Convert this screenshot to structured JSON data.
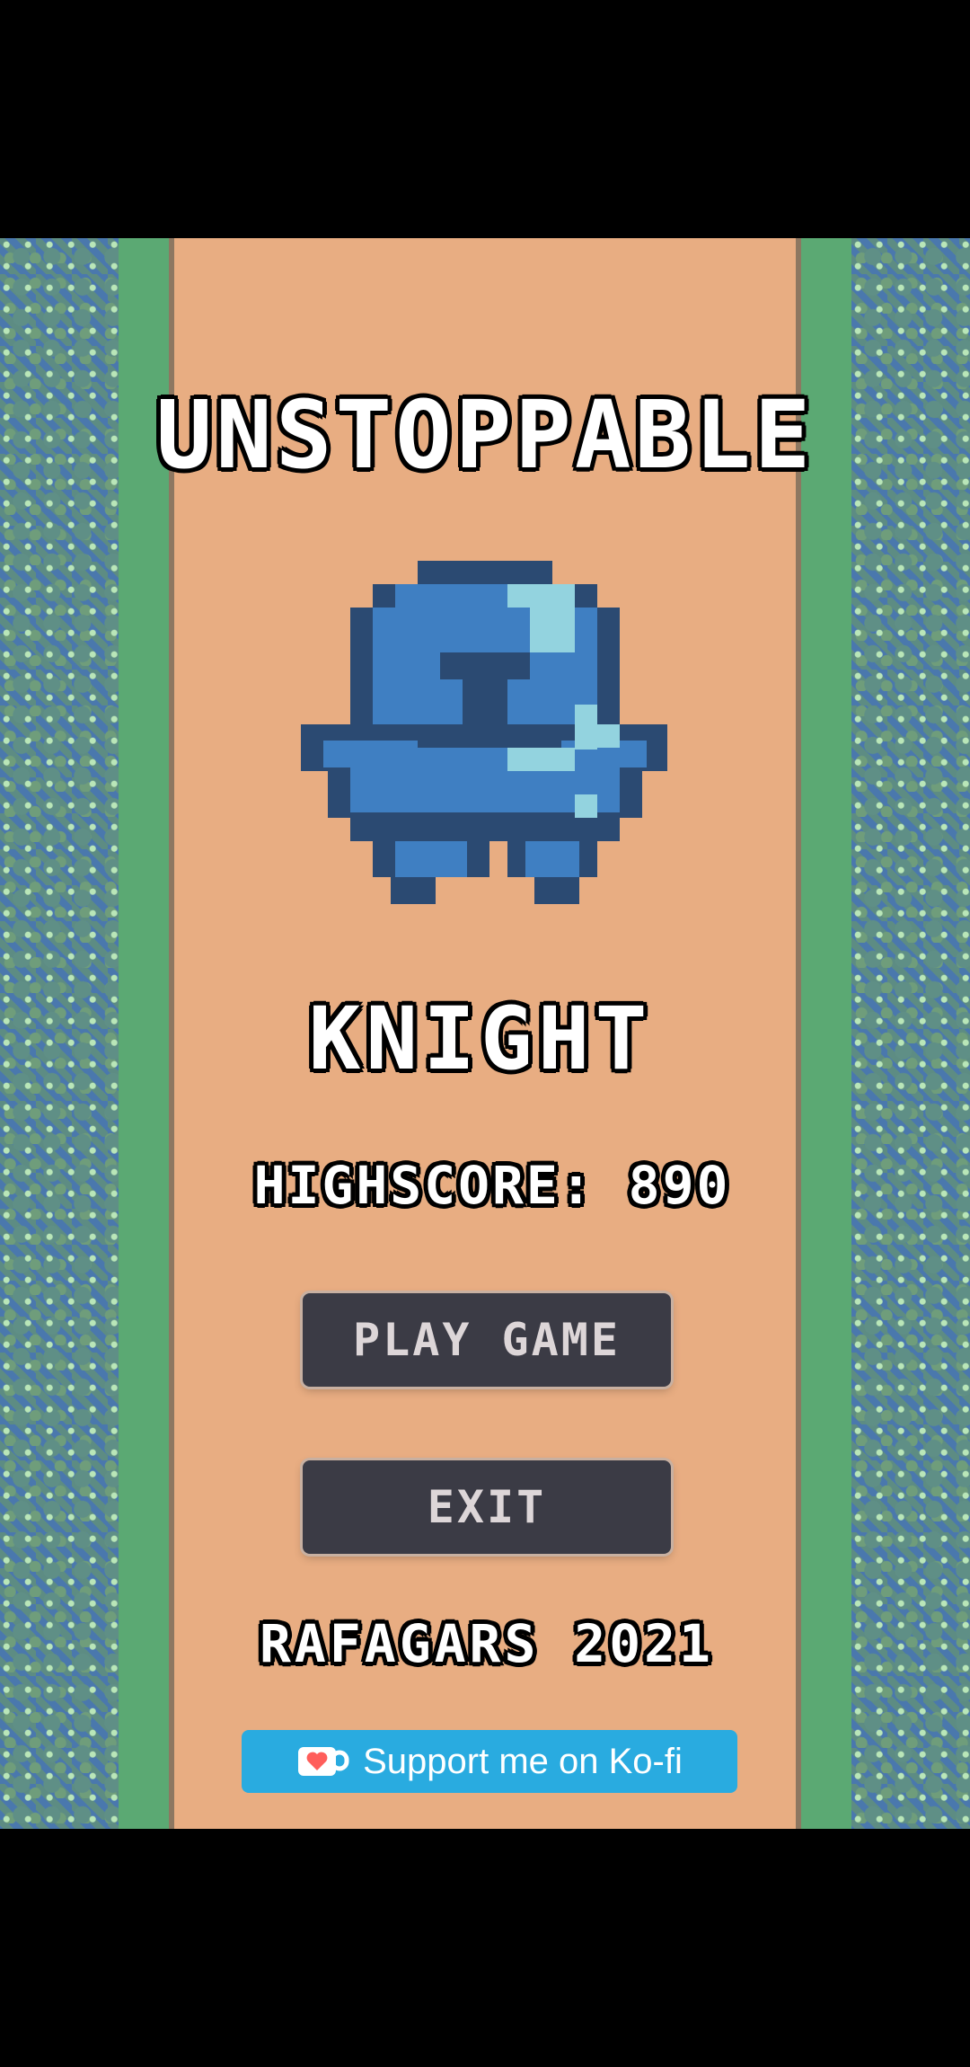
{
  "title": "UNSTOPPABLE",
  "subtitle": "KNIGHT",
  "highscore": "HIGHSCORE: 890",
  "buttons": {
    "play": "PLAY GAME",
    "exit": "EXIT"
  },
  "credits": "RAFAGARS 2021",
  "kofi_button": {
    "label": "Support me on Ko-fi",
    "icon": "kofi-cup-heart-icon"
  },
  "colors": {
    "path": "#e8ad82",
    "grass": "#5ba973",
    "button": "#3b3b45",
    "kofi": "#29abe0",
    "knight_blue": "#3f7fc2",
    "knight_dark": "#2b4a72",
    "knight_light": "#93d3df"
  }
}
